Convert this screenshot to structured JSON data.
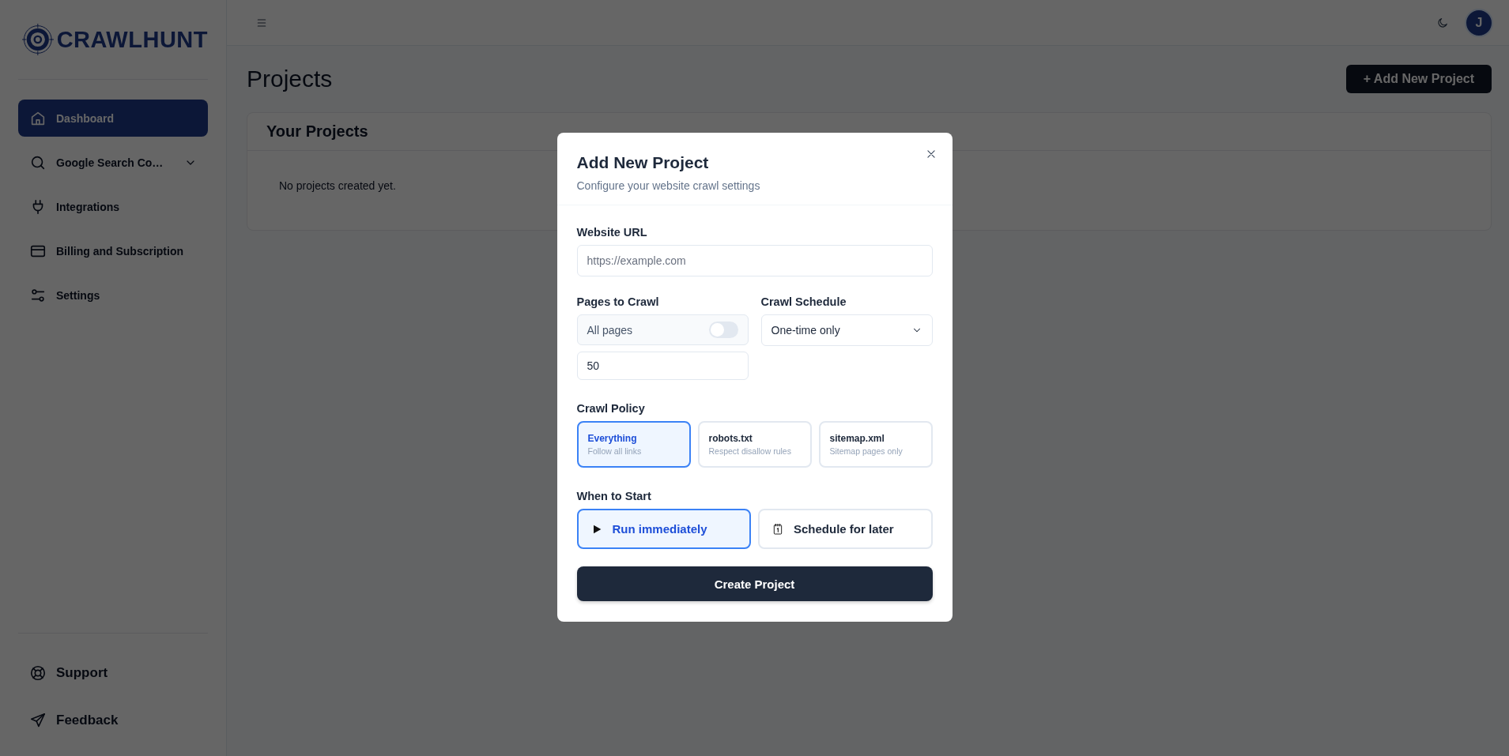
{
  "sidebar": {
    "logo": "CRAWLHUNT",
    "items": [
      {
        "label": "Dashboard",
        "selected": true
      },
      {
        "label": "Google Search Co…",
        "selected": false,
        "expanded": false
      },
      {
        "label": "Integrations",
        "selected": false
      },
      {
        "label": "Billing and Subscription",
        "selected": false
      },
      {
        "label": "Settings",
        "selected": false
      }
    ],
    "footer_items": [
      {
        "label": "Support"
      },
      {
        "label": "Feedback"
      }
    ]
  },
  "header": {
    "avatar": "J"
  },
  "main": {
    "title": "Projects",
    "add_button": "+ Add New Project",
    "card_title": "Your Projects",
    "empty_text": "No projects created yet."
  },
  "modal": {
    "title": "Add New Project",
    "subtitle": "Configure your website crawl settings",
    "url": {
      "label": "Website URL",
      "placeholder": "https://example.com"
    },
    "pages": {
      "label": "Pages to Crawl",
      "toggle_label": "All pages",
      "on": false,
      "value": "50"
    },
    "schedule": {
      "label": "Crawl Schedule",
      "value": "One-time only"
    },
    "policy": {
      "label": "Crawl Policy",
      "options": [
        {
          "title": "Everything",
          "subtitle": "Follow all links",
          "selected": true
        },
        {
          "title": "robots.txt",
          "subtitle": "Respect disallow rules",
          "selected": false
        },
        {
          "title": "sitemap.xml",
          "subtitle": "Sitemap pages only",
          "selected": false
        }
      ]
    },
    "start": {
      "label": "When to Start",
      "options": [
        {
          "label": "Run immediately",
          "selected": true
        },
        {
          "label": "Schedule for later",
          "selected": false
        }
      ]
    },
    "submit": "Create Project"
  }
}
